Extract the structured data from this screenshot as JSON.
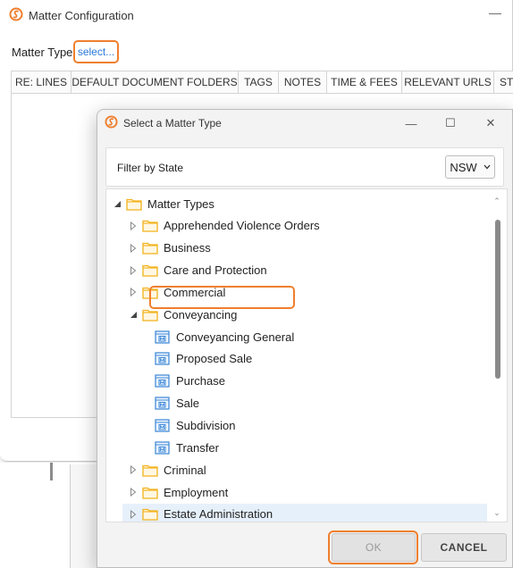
{
  "background_window": {
    "title": "Matter Configuration",
    "minimize": "—",
    "matter_type_label": "Matter Type:",
    "matter_type_value": "select...",
    "tabs": [
      {
        "label": "RE: LINES",
        "active": false
      },
      {
        "label": "DEFAULT DOCUMENT FOLDERS",
        "active": false
      },
      {
        "label": "TAGS",
        "active": false
      },
      {
        "label": "NOTES",
        "active": false
      },
      {
        "label": "TIME & FEES",
        "active": true
      },
      {
        "label": "RELEVANT URLS",
        "active": false
      },
      {
        "label": "ST",
        "active": false
      }
    ]
  },
  "dialog": {
    "title": "Select a Matter Type",
    "controls": {
      "minimize": "—",
      "maximize": "☐",
      "close": "✕"
    },
    "filter_label": "Filter by State",
    "state_value": "NSW",
    "tree": [
      {
        "label": "Matter Types",
        "icon": "folder-icon",
        "toggle": "expanded"
      },
      {
        "label": "Apprehended Violence Orders",
        "icon": "folder-icon",
        "toggle": "collapsed"
      },
      {
        "label": "Business",
        "icon": "folder-icon",
        "toggle": "collapsed"
      },
      {
        "label": "Care and Protection",
        "icon": "folder-icon",
        "toggle": "collapsed"
      },
      {
        "label": "Commercial",
        "icon": "folder-icon",
        "toggle": "collapsed"
      },
      {
        "label": "Conveyancing",
        "icon": "folder-icon",
        "toggle": "expanded"
      },
      {
        "label": "Conveyancing General",
        "icon": "matter-type-icon",
        "toggle": "none",
        "highlighted": true
      },
      {
        "label": "Proposed Sale",
        "icon": "matter-type-icon",
        "toggle": "none"
      },
      {
        "label": "Purchase",
        "icon": "matter-type-icon",
        "toggle": "none"
      },
      {
        "label": "Sale",
        "icon": "matter-type-icon",
        "toggle": "none"
      },
      {
        "label": "Subdivision",
        "icon": "matter-type-icon",
        "toggle": "none"
      },
      {
        "label": "Transfer",
        "icon": "matter-type-icon",
        "toggle": "none"
      },
      {
        "label": "Criminal",
        "icon": "folder-icon",
        "toggle": "collapsed"
      },
      {
        "label": "Employment",
        "icon": "folder-icon",
        "toggle": "collapsed"
      },
      {
        "label": "Estate Administration",
        "icon": "folder-icon",
        "toggle": "collapsed",
        "hover": true
      }
    ],
    "ok_label": "OK",
    "cancel_label": "CANCEL"
  },
  "colors": {
    "accent_orange": "#ef7f2e",
    "link_blue": "#2a78d8",
    "folder_yellow": "#f2b21b",
    "matter_icon_blue": "#3a86d6",
    "hover_row": "#e6f0fb"
  }
}
